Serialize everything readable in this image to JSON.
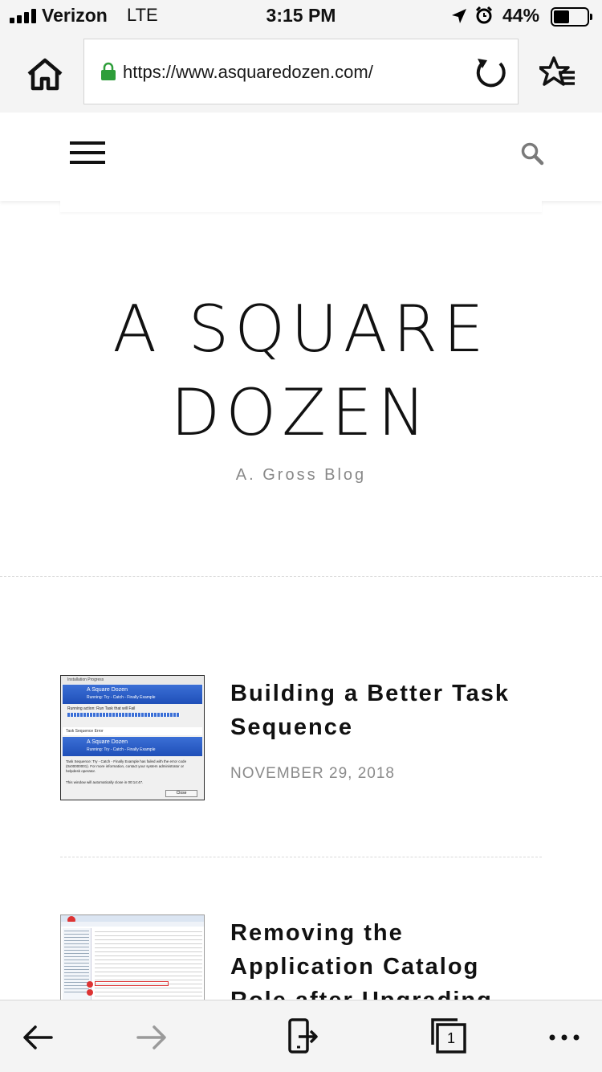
{
  "status_bar": {
    "carrier": "Verizon",
    "network": "LTE",
    "time": "3:15 PM",
    "battery_percent": "44%",
    "battery_level": 0.44,
    "icons": [
      "signal-icon",
      "location-arrow-icon",
      "alarm-clock-icon",
      "battery-icon"
    ]
  },
  "browser": {
    "url": "https://www.asquaredozen.com/",
    "icons": [
      "home-icon",
      "lock-icon",
      "reload-icon",
      "favorites-star-icon"
    ]
  },
  "site": {
    "title_line1": "A SQUARE",
    "title_line2": "DOZEN",
    "tagline": "A. Gross Blog",
    "icons": [
      "menu-icon",
      "search-icon"
    ]
  },
  "posts": [
    {
      "title": "Building a Better Task Sequence",
      "date": "NOVEMBER 29, 2018",
      "thumbnail": {
        "caption": "Installation Progress",
        "banner_title": "A Square Dozen",
        "banner_subtitle": "Running: Try - Catch - Finally Example",
        "running_action": "Running action: Run Task that will Fail",
        "error_caption": "Task Sequence Error",
        "error_message": "Task Sequence: Try - Catch - Finally Example has failed with the error code (0x00000001). For more information, contact your system administrator or helpdesk operator.",
        "close_note": "This window will automatically close in 00:14:47.",
        "close_label": "Close"
      }
    },
    {
      "title": "Removing the Application Catalog Role after Upgrading",
      "date": ""
    }
  ],
  "bottom_bar": {
    "tab_count": "1",
    "icons": [
      "back-arrow-icon",
      "forward-arrow-icon",
      "share-icon",
      "tabs-icon",
      "more-icon"
    ]
  },
  "colors": {
    "chrome_bg": "#f4f4f4",
    "lock_green": "#2e9e3a",
    "thumb_blue": "#1f4fb8",
    "muted_text": "#8a8a8a"
  }
}
